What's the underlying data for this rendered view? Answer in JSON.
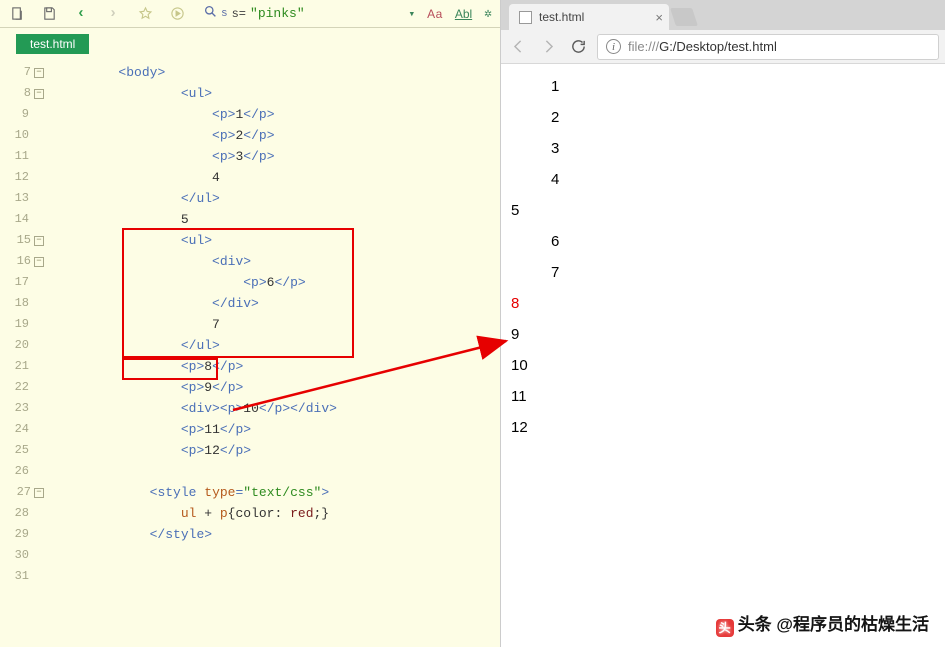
{
  "editor": {
    "toolbar": {
      "search_label": "s=",
      "search_value": "\"pinks\"",
      "aa_label": "Aa",
      "abl_label": "Abl"
    },
    "tab_label": "test.html",
    "gutter_start": 7,
    "lines": [
      {
        "n": 7,
        "fold": true,
        "segs": [
          {
            "ind": 2
          },
          {
            "c": "tag-b",
            "t": "<"
          },
          {
            "c": "tag-n",
            "t": "body"
          },
          {
            "c": "tag-b",
            "t": ">"
          }
        ]
      },
      {
        "n": 8,
        "fold": true,
        "segs": [
          {
            "ind": 4
          },
          {
            "c": "tag-b",
            "t": "<"
          },
          {
            "c": "tag-n",
            "t": "ul"
          },
          {
            "c": "tag-b",
            "t": ">"
          }
        ]
      },
      {
        "n": 9,
        "segs": [
          {
            "ind": 5
          },
          {
            "c": "tag-b",
            "t": "<"
          },
          {
            "c": "tag-n",
            "t": "p"
          },
          {
            "c": "tag-b",
            "t": ">"
          },
          {
            "c": "txt",
            "t": "1"
          },
          {
            "c": "tag-b",
            "t": "</"
          },
          {
            "c": "tag-n",
            "t": "p"
          },
          {
            "c": "tag-b",
            "t": ">"
          }
        ]
      },
      {
        "n": 10,
        "segs": [
          {
            "ind": 5
          },
          {
            "c": "tag-b",
            "t": "<"
          },
          {
            "c": "tag-n",
            "t": "p"
          },
          {
            "c": "tag-b",
            "t": ">"
          },
          {
            "c": "txt",
            "t": "2"
          },
          {
            "c": "tag-b",
            "t": "</"
          },
          {
            "c": "tag-n",
            "t": "p"
          },
          {
            "c": "tag-b",
            "t": ">"
          }
        ]
      },
      {
        "n": 11,
        "segs": [
          {
            "ind": 5
          },
          {
            "c": "tag-b",
            "t": "<"
          },
          {
            "c": "tag-n",
            "t": "p"
          },
          {
            "c": "tag-b",
            "t": ">"
          },
          {
            "c": "txt",
            "t": "3"
          },
          {
            "c": "tag-b",
            "t": "</"
          },
          {
            "c": "tag-n",
            "t": "p"
          },
          {
            "c": "tag-b",
            "t": ">"
          }
        ]
      },
      {
        "n": 12,
        "segs": [
          {
            "ind": 5
          },
          {
            "c": "txt",
            "t": "4"
          }
        ]
      },
      {
        "n": 13,
        "segs": [
          {
            "ind": 4
          },
          {
            "c": "tag-b",
            "t": "</"
          },
          {
            "c": "tag-n",
            "t": "ul"
          },
          {
            "c": "tag-b",
            "t": ">"
          }
        ]
      },
      {
        "n": 14,
        "segs": [
          {
            "ind": 4
          },
          {
            "c": "txt",
            "t": "5"
          }
        ]
      },
      {
        "n": 15,
        "fold": true,
        "segs": [
          {
            "ind": 4
          },
          {
            "c": "tag-b",
            "t": "<"
          },
          {
            "c": "tag-n",
            "t": "ul"
          },
          {
            "c": "tag-b",
            "t": ">"
          }
        ]
      },
      {
        "n": 16,
        "fold": true,
        "segs": [
          {
            "ind": 5
          },
          {
            "c": "tag-b",
            "t": "<"
          },
          {
            "c": "tag-n",
            "t": "div"
          },
          {
            "c": "tag-b",
            "t": ">"
          }
        ]
      },
      {
        "n": 17,
        "segs": [
          {
            "ind": 6
          },
          {
            "c": "tag-b",
            "t": "<"
          },
          {
            "c": "tag-n",
            "t": "p"
          },
          {
            "c": "tag-b",
            "t": ">"
          },
          {
            "c": "txt",
            "t": "6"
          },
          {
            "c": "tag-b",
            "t": "</"
          },
          {
            "c": "tag-n",
            "t": "p"
          },
          {
            "c": "tag-b",
            "t": ">"
          }
        ]
      },
      {
        "n": 18,
        "segs": [
          {
            "ind": 5
          },
          {
            "c": "tag-b",
            "t": "</"
          },
          {
            "c": "tag-n",
            "t": "div"
          },
          {
            "c": "tag-b",
            "t": ">"
          }
        ]
      },
      {
        "n": 19,
        "segs": [
          {
            "ind": 5
          },
          {
            "c": "txt",
            "t": "7"
          }
        ]
      },
      {
        "n": 20,
        "segs": [
          {
            "ind": 4
          },
          {
            "c": "tag-b",
            "t": "</"
          },
          {
            "c": "tag-n",
            "t": "ul"
          },
          {
            "c": "tag-b",
            "t": ">"
          }
        ]
      },
      {
        "n": 21,
        "segs": [
          {
            "ind": 4
          },
          {
            "c": "tag-b",
            "t": "<"
          },
          {
            "c": "tag-n",
            "t": "p"
          },
          {
            "c": "tag-b",
            "t": ">"
          },
          {
            "c": "txt",
            "t": "8"
          },
          {
            "c": "tag-b",
            "t": "</"
          },
          {
            "c": "tag-n",
            "t": "p"
          },
          {
            "c": "tag-b",
            "t": ">"
          }
        ]
      },
      {
        "n": 22,
        "segs": [
          {
            "ind": 4
          },
          {
            "c": "tag-b",
            "t": "<"
          },
          {
            "c": "tag-n",
            "t": "p"
          },
          {
            "c": "tag-b",
            "t": ">"
          },
          {
            "c": "txt",
            "t": "9"
          },
          {
            "c": "tag-b",
            "t": "</"
          },
          {
            "c": "tag-n",
            "t": "p"
          },
          {
            "c": "tag-b",
            "t": ">"
          }
        ]
      },
      {
        "n": 23,
        "segs": [
          {
            "ind": 4
          },
          {
            "c": "tag-b",
            "t": "<"
          },
          {
            "c": "tag-n",
            "t": "div"
          },
          {
            "c": "tag-b",
            "t": "><"
          },
          {
            "c": "tag-n",
            "t": "p"
          },
          {
            "c": "tag-b",
            "t": ">"
          },
          {
            "c": "txt",
            "t": "10"
          },
          {
            "c": "tag-b",
            "t": "</"
          },
          {
            "c": "tag-n",
            "t": "p"
          },
          {
            "c": "tag-b",
            "t": "></"
          },
          {
            "c": "tag-n",
            "t": "div"
          },
          {
            "c": "tag-b",
            "t": ">"
          }
        ]
      },
      {
        "n": 24,
        "segs": [
          {
            "ind": 4
          },
          {
            "c": "tag-b",
            "t": "<"
          },
          {
            "c": "tag-n",
            "t": "p"
          },
          {
            "c": "tag-b",
            "t": ">"
          },
          {
            "c": "txt",
            "t": "11"
          },
          {
            "c": "tag-b",
            "t": "</"
          },
          {
            "c": "tag-n",
            "t": "p"
          },
          {
            "c": "tag-b",
            "t": ">"
          }
        ]
      },
      {
        "n": 25,
        "segs": [
          {
            "ind": 4
          },
          {
            "c": "tag-b",
            "t": "<"
          },
          {
            "c": "tag-n",
            "t": "p"
          },
          {
            "c": "tag-b",
            "t": ">"
          },
          {
            "c": "txt",
            "t": "12"
          },
          {
            "c": "tag-b",
            "t": "</"
          },
          {
            "c": "tag-n",
            "t": "p"
          },
          {
            "c": "tag-b",
            "t": ">"
          }
        ]
      },
      {
        "n": 26,
        "segs": []
      },
      {
        "n": 27,
        "fold": true,
        "segs": [
          {
            "ind": 3
          },
          {
            "c": "tag-b",
            "t": "<"
          },
          {
            "c": "tag-n",
            "t": "style"
          },
          {
            "c": "txt",
            "t": " "
          },
          {
            "c": "attr-n",
            "t": "type"
          },
          {
            "c": "tag-b",
            "t": "="
          },
          {
            "c": "attr-v",
            "t": "\"text/css\""
          },
          {
            "c": "tag-b",
            "t": ">"
          }
        ]
      },
      {
        "n": 28,
        "segs": [
          {
            "ind": 4
          },
          {
            "c": "sel-k",
            "t": "ul"
          },
          {
            "c": "sel-o",
            "t": " + "
          },
          {
            "c": "sel-k",
            "t": "p"
          },
          {
            "c": "sel-o",
            "t": "{"
          },
          {
            "c": "css-p",
            "t": "color"
          },
          {
            "c": "sel-o",
            "t": ": "
          },
          {
            "c": "css-v",
            "t": "red"
          },
          {
            "c": "sel-o",
            "t": ";}"
          }
        ]
      },
      {
        "n": 29,
        "segs": [
          {
            "ind": 3
          },
          {
            "c": "tag-b",
            "t": "</"
          },
          {
            "c": "tag-n",
            "t": "style"
          },
          {
            "c": "tag-b",
            "t": ">"
          }
        ]
      },
      {
        "n": 30,
        "segs": []
      },
      {
        "n": 31,
        "segs": []
      }
    ]
  },
  "browser": {
    "tab_title": "test.html",
    "url_host": "file:///",
    "url_path": "G:/Desktop/test.html",
    "rendered_items": [
      {
        "text": "1",
        "indent": 1,
        "red": false
      },
      {
        "text": "2",
        "indent": 1,
        "red": false
      },
      {
        "text": "3",
        "indent": 1,
        "red": false
      },
      {
        "text": "4",
        "indent": 1,
        "red": false
      },
      {
        "text": "5",
        "indent": 0,
        "red": false
      },
      {
        "text": "6",
        "indent": 1,
        "red": false
      },
      {
        "text": "7",
        "indent": 1,
        "red": false
      },
      {
        "text": "8",
        "indent": 0,
        "red": true
      },
      {
        "text": "9",
        "indent": 0,
        "red": false
      },
      {
        "text": "10",
        "indent": 0,
        "red": false
      },
      {
        "text": "11",
        "indent": 0,
        "red": false
      },
      {
        "text": "12",
        "indent": 0,
        "red": false
      }
    ]
  },
  "watermark": "头条 @程序员的枯燥生活"
}
